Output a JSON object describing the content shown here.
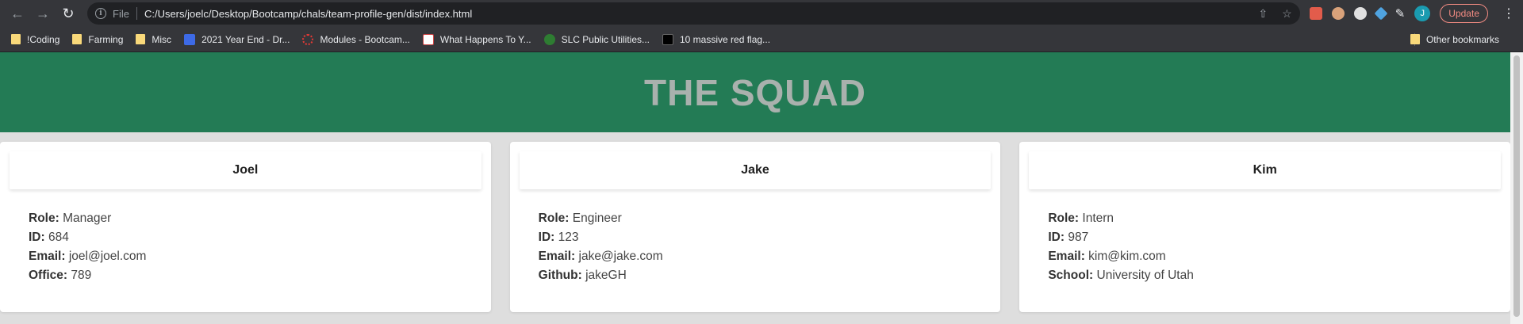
{
  "browser": {
    "file_label": "File",
    "url": "C:/Users/joelc/Desktop/Bootcamp/chals/team-profile-gen/dist/index.html",
    "avatar_letter": "J",
    "update_label": "Update",
    "bookmarks": [
      {
        "label": "!Coding",
        "icon": "folder-icon"
      },
      {
        "label": "Farming",
        "icon": "folder-icon"
      },
      {
        "label": "Misc",
        "icon": "folder-icon"
      },
      {
        "label": "2021 Year End - Dr...",
        "icon": "dropbox-icon"
      },
      {
        "label": "Modules - Bootcam...",
        "icon": "modules-icon"
      },
      {
        "label": "What Happens To Y...",
        "icon": "site-icon"
      },
      {
        "label": "SLC Public Utilities...",
        "icon": "slc-icon"
      },
      {
        "label": "10 massive red flag...",
        "icon": "video-icon"
      }
    ],
    "other_bookmarks": "Other bookmarks"
  },
  "page": {
    "title": "THE SQUAD",
    "colors": {
      "header_bg": "#237b55",
      "title_color": "#a9b1ad"
    },
    "cards": [
      {
        "name": "Joel",
        "rows": [
          {
            "label": "Role:",
            "value": "Manager"
          },
          {
            "label": "ID:",
            "value": "684"
          },
          {
            "label": "Email:",
            "value": "joel@joel.com"
          },
          {
            "label": "Office:",
            "value": "789"
          }
        ]
      },
      {
        "name": "Jake",
        "rows": [
          {
            "label": "Role:",
            "value": "Engineer"
          },
          {
            "label": "ID:",
            "value": "123"
          },
          {
            "label": "Email:",
            "value": "jake@jake.com"
          },
          {
            "label": "Github:",
            "value": "jakeGH"
          }
        ]
      },
      {
        "name": "Kim",
        "rows": [
          {
            "label": "Role:",
            "value": "Intern"
          },
          {
            "label": "ID:",
            "value": "987"
          },
          {
            "label": "Email:",
            "value": "kim@kim.com"
          },
          {
            "label": "School:",
            "value": "University of Utah"
          }
        ]
      }
    ]
  }
}
